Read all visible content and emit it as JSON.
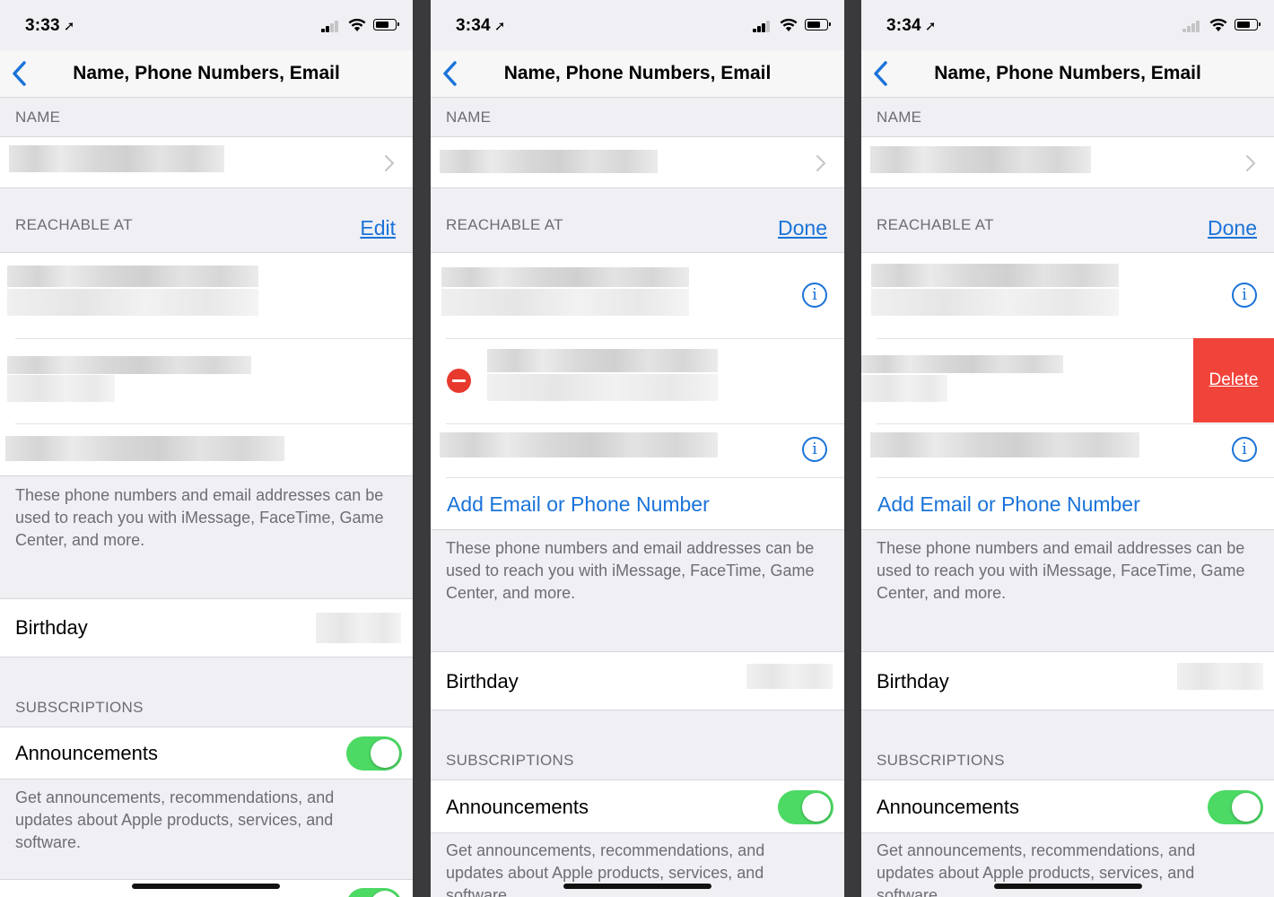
{
  "screens": [
    {
      "time": "3:33",
      "nav_title": "Name, Phone Numbers, Email",
      "name_header": "NAME",
      "reachable_header": "REACHABLE AT",
      "reachable_action": "Edit",
      "reachable_footer": "These phone numbers and email addresses can be used to reach you with iMessage, FaceTime, Game Center, and more.",
      "birthday_label": "Birthday",
      "subscriptions_header": "SUBSCRIPTIONS",
      "announcements_label": "Announcements",
      "announcements_footer": "Get announcements, recommendations, and updates about Apple products, services, and software.",
      "announcements_on": true
    },
    {
      "time": "3:34",
      "nav_title": "Name, Phone Numbers, Email",
      "name_header": "NAME",
      "reachable_header": "REACHABLE AT",
      "reachable_action": "Done",
      "add_label": "Add Email or Phone Number",
      "reachable_footer": "These phone numbers and email addresses can be used to reach you with iMessage, FaceTime, Game Center, and more.",
      "birthday_label": "Birthday",
      "subscriptions_header": "SUBSCRIPTIONS",
      "announcements_label": "Announcements",
      "announcements_footer": "Get announcements, recommendations, and updates about Apple products, services, and software.",
      "announcements_on": true
    },
    {
      "time": "3:34",
      "nav_title": "Name, Phone Numbers, Email",
      "name_header": "NAME",
      "reachable_header": "REACHABLE AT",
      "reachable_action": "Done",
      "add_label": "Add Email or Phone Number",
      "delete_label": "Delete",
      "reachable_footer": "These phone numbers and email addresses can be used to reach you with iMessage, FaceTime, Game Center, and more.",
      "birthday_label": "Birthday",
      "subscriptions_header": "SUBSCRIPTIONS",
      "announcements_label": "Announcements",
      "announcements_footer": "Get announcements, recommendations, and updates about Apple products, services, and software.",
      "announcements_on": true
    }
  ],
  "icons": {
    "back": "chevron-left-icon",
    "disclosure": "chevron-right-icon",
    "info": "info-circle-icon",
    "remove": "minus-circle-icon",
    "location": "location-arrow-icon",
    "signal": "cellular-signal-icon",
    "wifi": "wifi-icon",
    "battery": "battery-icon"
  },
  "colors": {
    "accent": "#1a73d9",
    "toggle_on": "#4cd964",
    "delete": "#f0433a",
    "background": "#efeff4"
  }
}
